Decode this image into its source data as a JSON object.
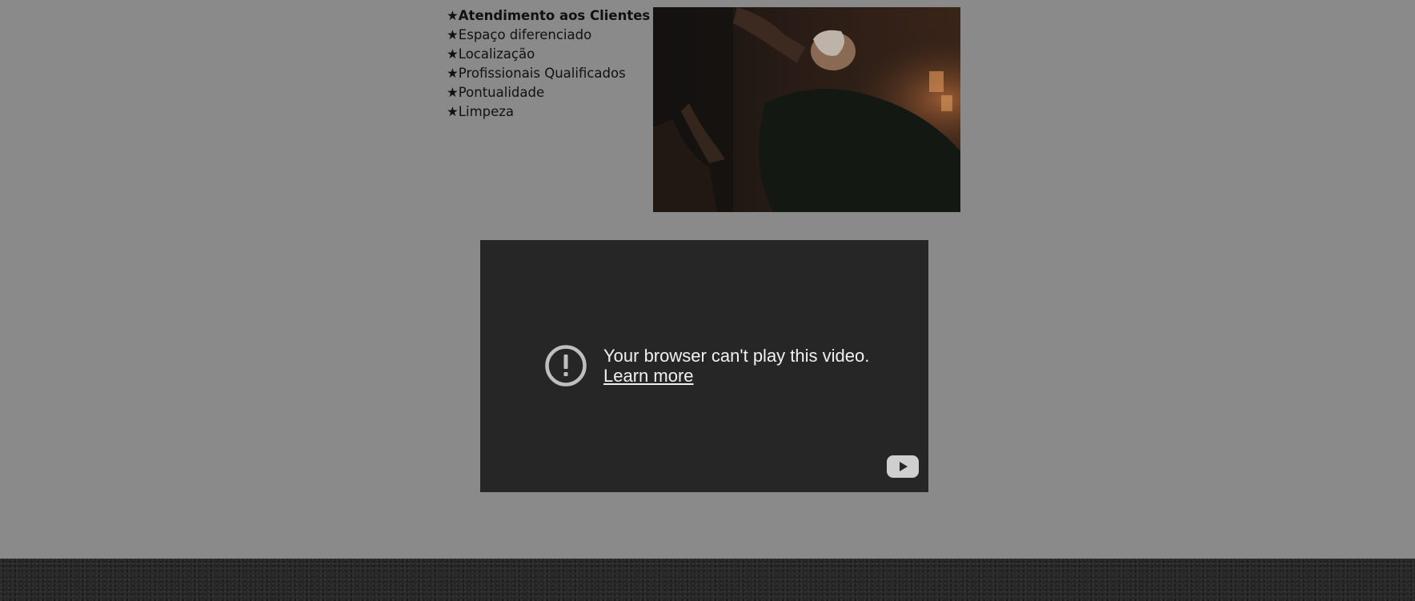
{
  "features": [
    "★Atendimento aos Clientes",
    "★Espaço diferenciado",
    "★Localização",
    "★Profissionais Qualificados",
    "★Pontualidade",
    "★Limpeza"
  ],
  "video": {
    "error_message": "Your browser can't play this video.",
    "learn_more_label": "Learn more"
  },
  "colors": {
    "page_background": "#8a8a8a",
    "video_background": "#262626",
    "footer_background": "#262626"
  },
  "icons": {
    "alert": "alert-circle-icon",
    "youtube": "youtube-logo-icon"
  }
}
